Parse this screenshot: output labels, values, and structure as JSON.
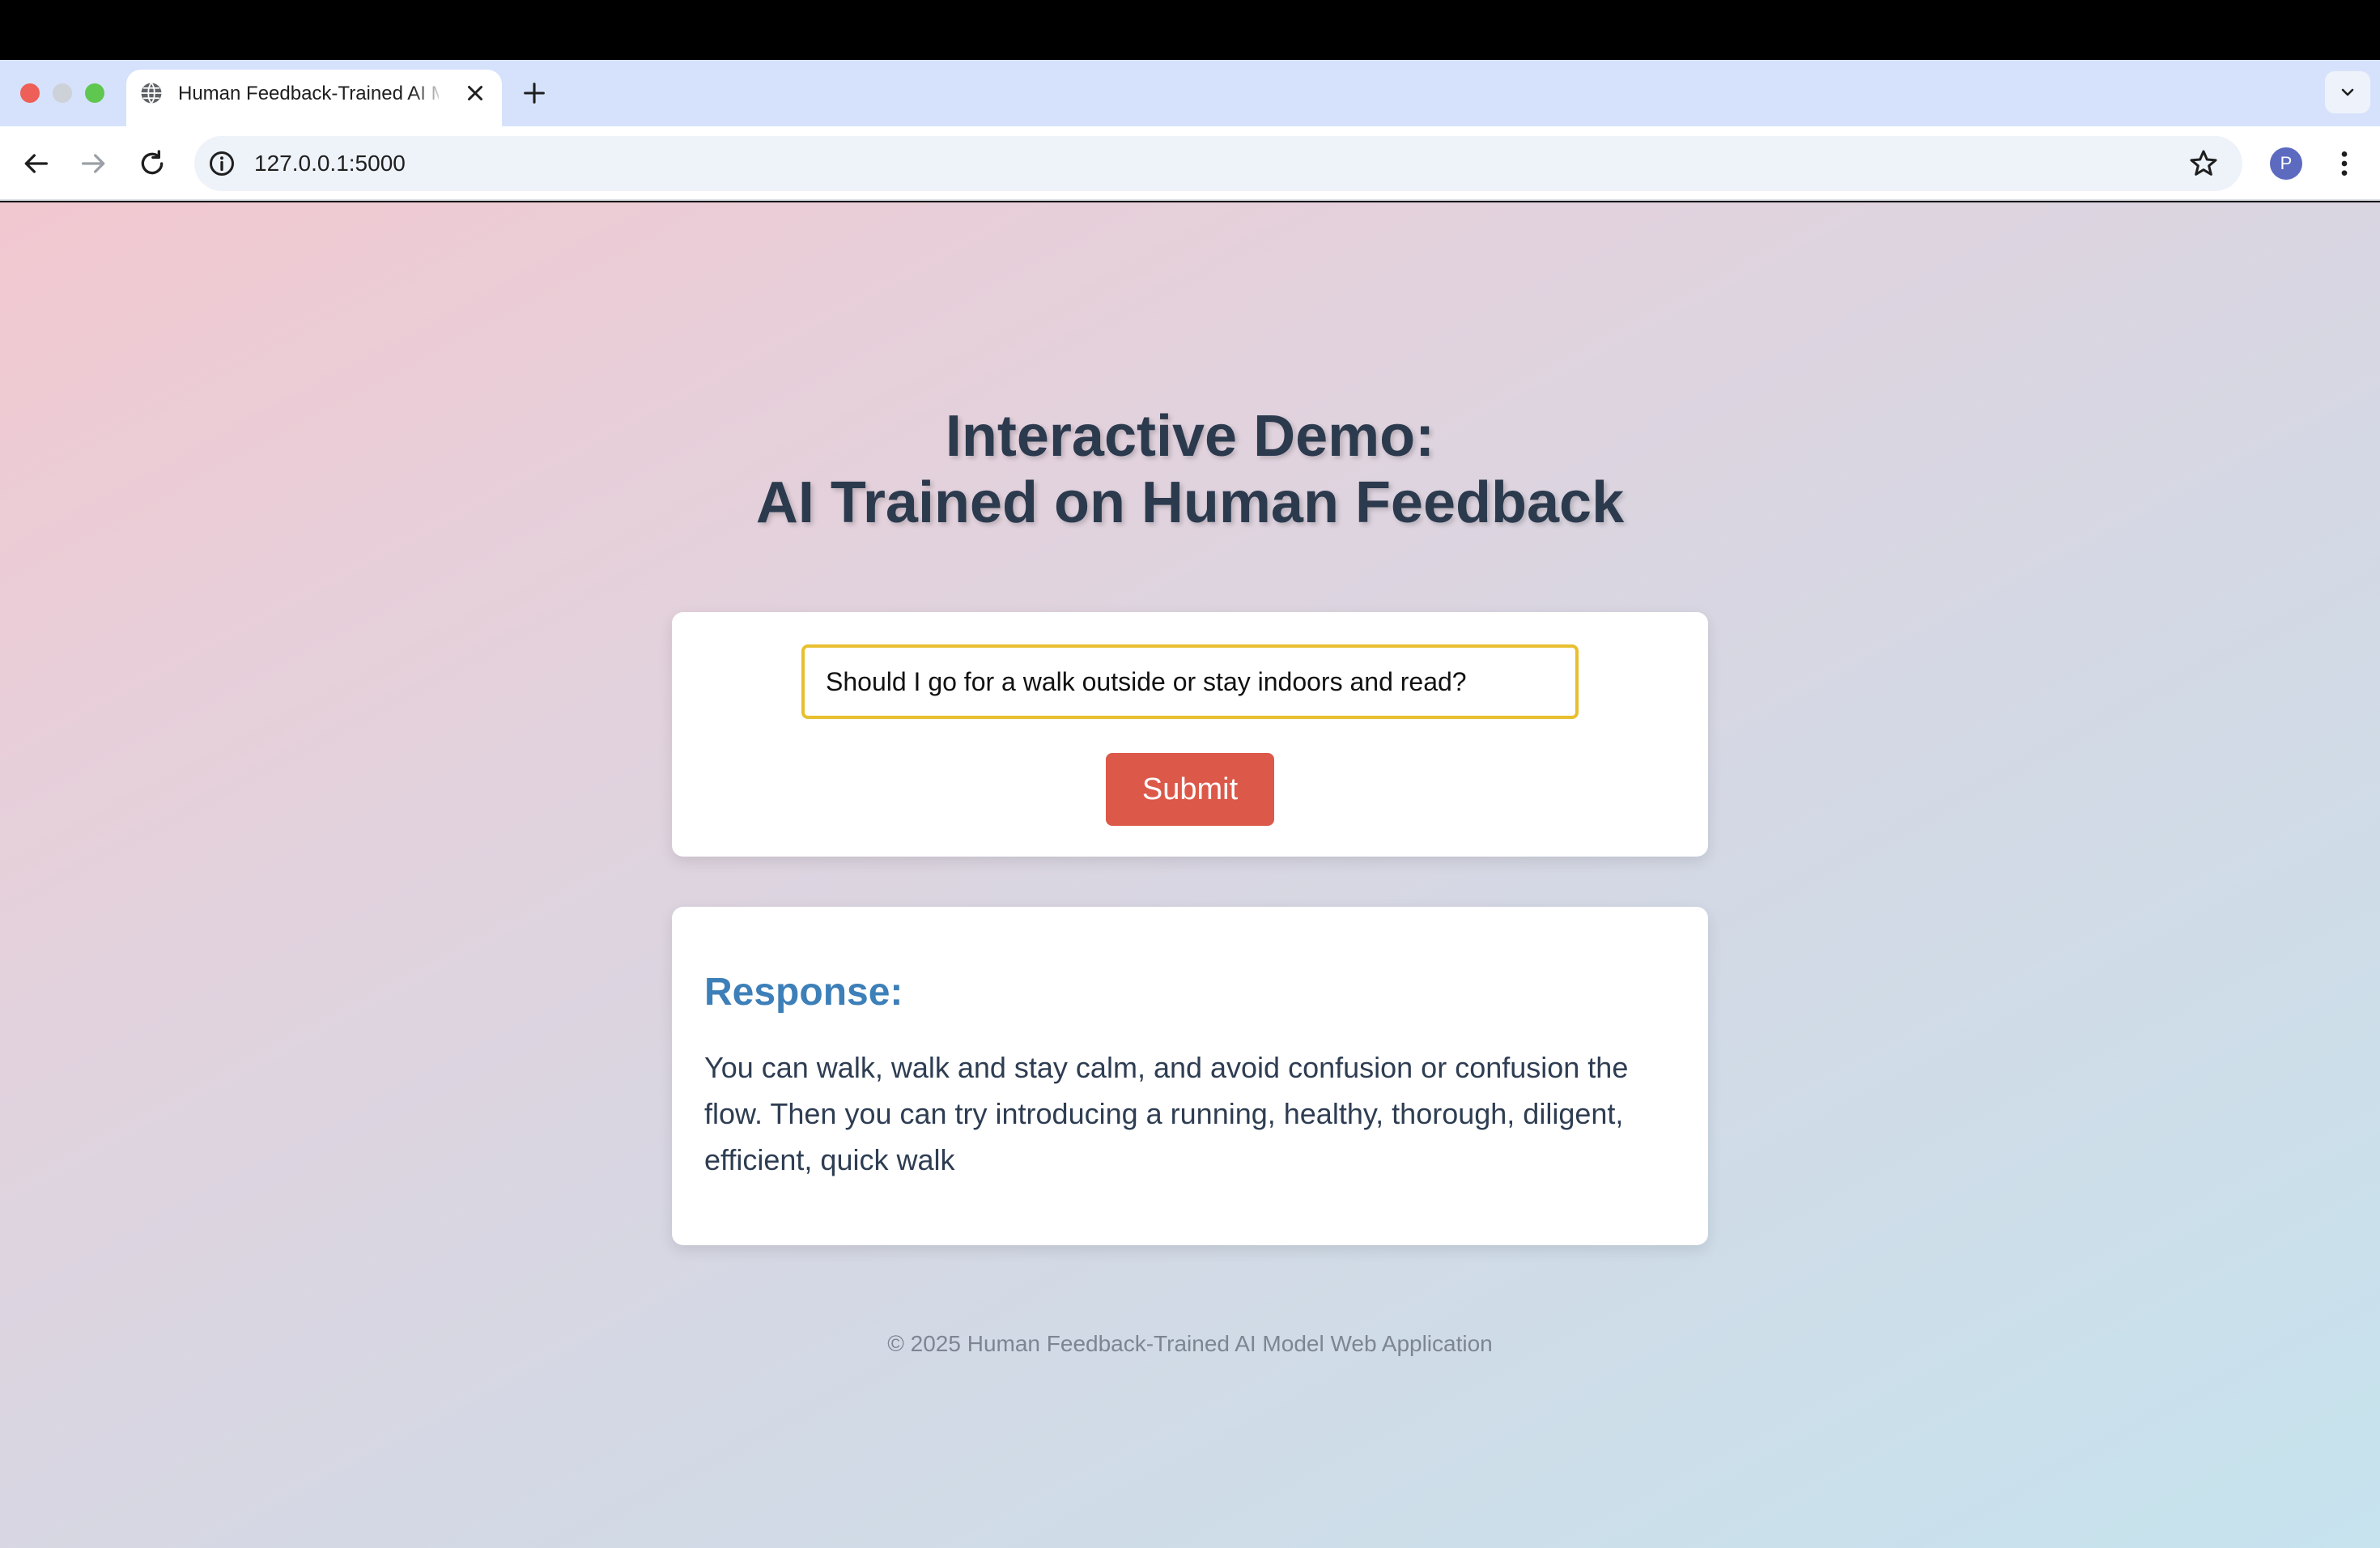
{
  "browser": {
    "tab_title": "Human Feedback-Trained AI Model Web Application",
    "url": "127.0.0.1:5000",
    "profile_initial": "P",
    "icons": [
      "close-window",
      "minimize-window",
      "maximize-window",
      "globe-icon",
      "close-icon",
      "plus-icon",
      "chevron-down-icon",
      "back-arrow-icon",
      "forward-arrow-icon",
      "reload-icon",
      "info-icon",
      "star-icon",
      "more-vert-icon"
    ]
  },
  "page": {
    "heading_line1": "Interactive Demo:",
    "heading_line2": "AI Trained on Human Feedback",
    "form": {
      "input_value": "Should I go for a walk outside or stay indoors and read?",
      "submit_label": "Submit"
    },
    "response": {
      "title": "Response:",
      "text": "You can walk, walk and stay calm, and avoid confusion or confusion the flow. Then you can try introducing a running, healthy, thorough, diligent, efficient, quick walk"
    },
    "footer": "© 2025 Human Feedback-Trained AI Model Web Application"
  },
  "colors": {
    "accent_button": "#dc5848",
    "input_border": "#e8bf2e",
    "response_title": "#3d7fb8",
    "heading": "#2c3a4e"
  }
}
